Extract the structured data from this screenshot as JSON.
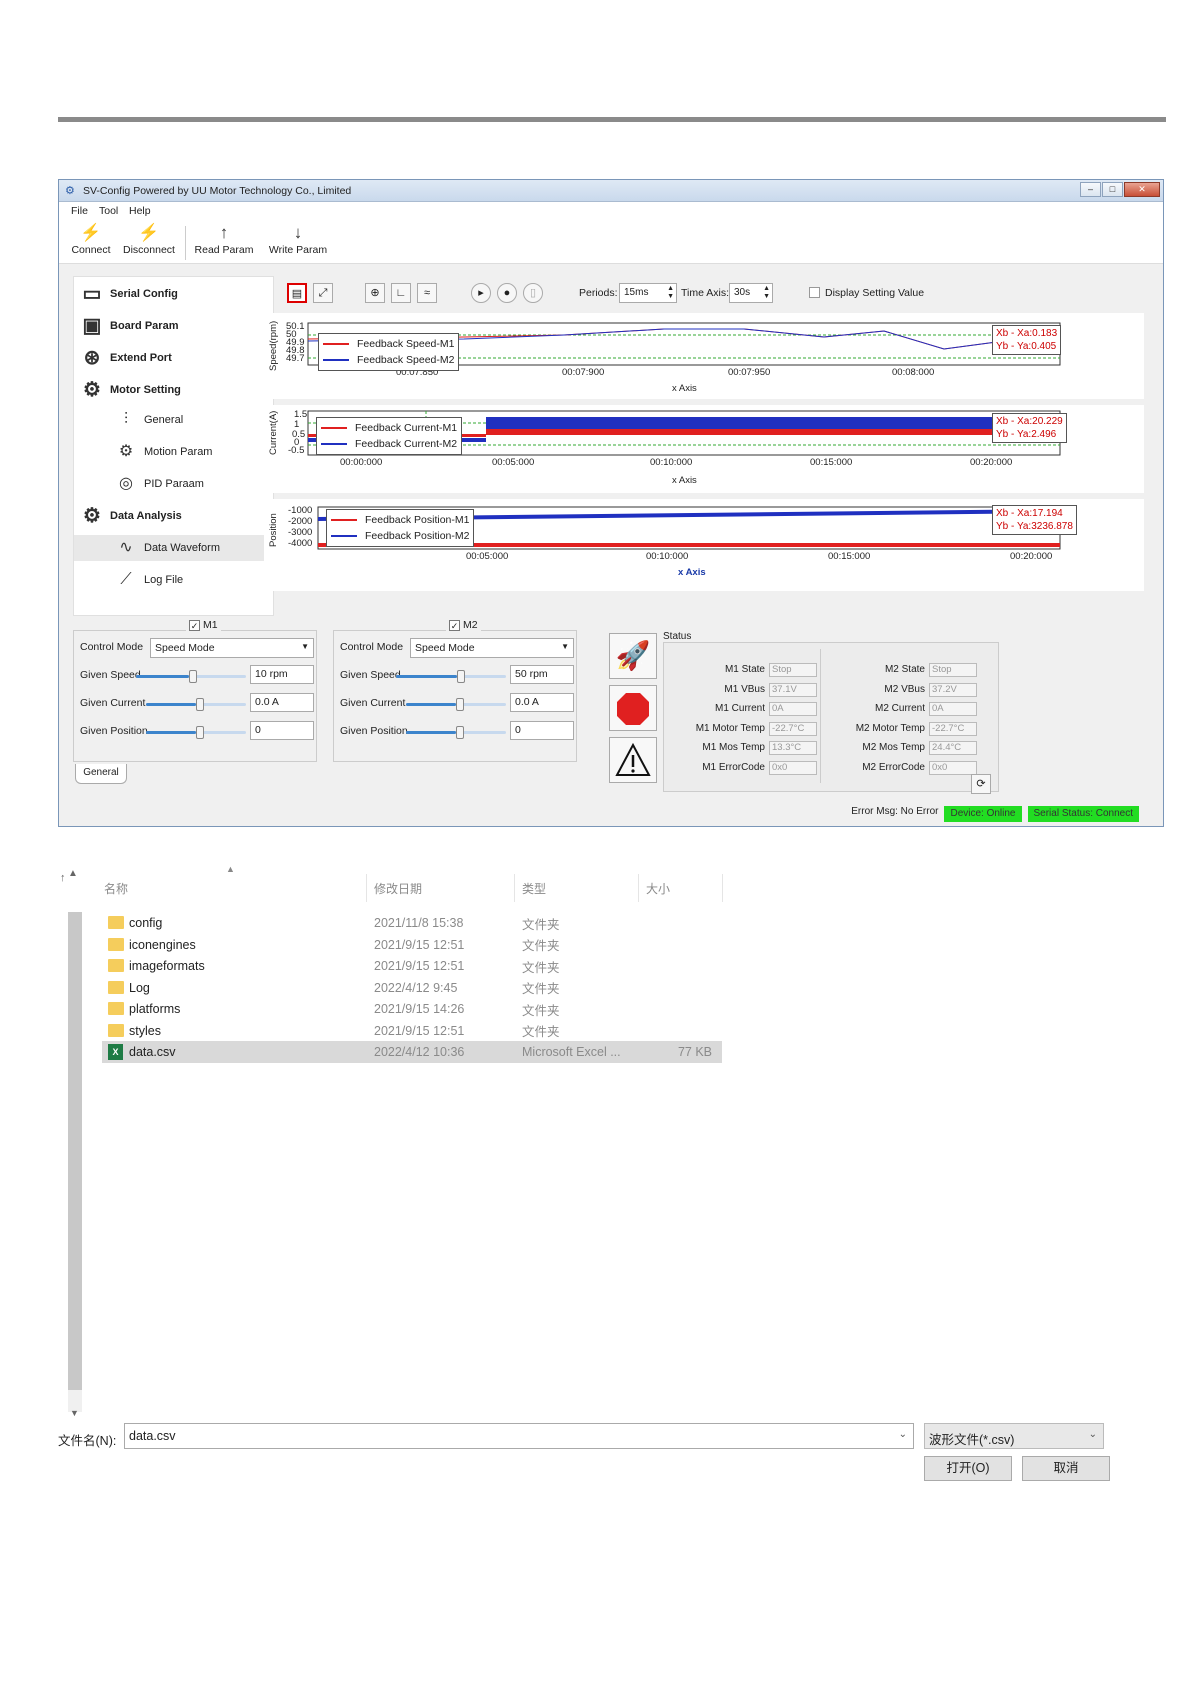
{
  "app": {
    "title": "SV-Config Powered by UU Motor Technology Co., Limited",
    "menu": [
      "File",
      "Tool",
      "Help"
    ],
    "toolbar": {
      "connect": "Connect",
      "disconnect": "Disconnect",
      "read": "Read Param",
      "write": "Write Param"
    },
    "sidebar": {
      "serial": "Serial Config",
      "board": "Board Param",
      "extend": "Extend Port",
      "motor": "Motor Setting",
      "general": "General",
      "motion": "Motion Param",
      "pid": "PID Paraam",
      "analysis": "Data Analysis",
      "waveform": "Data Waveform",
      "logfile": "Log File"
    },
    "controls": {
      "periods_label": "Periods:",
      "periods_value": "15ms",
      "timeaxis_label": "Time Axis:",
      "timeaxis_value": "30s",
      "display_setting": "Display Setting Value"
    },
    "plot1": {
      "ylabel": "Speed(rpm)",
      "xlabel": "x Axis",
      "yticks": [
        "50.1",
        "50",
        "49.9",
        "49.8",
        "49.7"
      ],
      "xticks": [
        "00:07:850",
        "00:07:900",
        "00:07:950",
        "00:08:000"
      ],
      "legend": [
        "Feedback Speed-M1",
        "Feedback Speed-M2"
      ],
      "readout": [
        "Xb - Xa:0.183",
        "Yb - Ya:0.405"
      ]
    },
    "plot2": {
      "ylabel": "Current(A)",
      "xlabel": "x Axis",
      "yticks": [
        "1.5",
        "1",
        "0.5",
        "0",
        "-0.5"
      ],
      "xticks": [
        "00:00:000",
        "00:05:000",
        "00:10:000",
        "00:15:000",
        "00:20:000"
      ],
      "legend": [
        "Feedback Current-M1",
        "Feedback Current-M2"
      ],
      "readout": [
        "Xb - Xa:20.229",
        "Yb - Ya:2.496"
      ]
    },
    "plot3": {
      "ylabel": "Position",
      "xlabel": "x Axis",
      "yticks": [
        "-1000",
        "-2000",
        "-3000",
        "-4000"
      ],
      "xticks": [
        "00:05:000",
        "00:10:000",
        "00:15:000",
        "00:20:000"
      ],
      "legend": [
        "Feedback Position-M1",
        "Feedback Position-M2"
      ],
      "readout": [
        "Xb - Xa:17.194",
        "Yb - Ya:3236.878"
      ]
    },
    "m1": {
      "title": "M1",
      "mode_label": "Control Mode",
      "mode": "Speed Mode",
      "speed_label": "Given Speed",
      "speed": "10 rpm",
      "current_label": "Given Current",
      "current": "0.0 A",
      "position_label": "Given Position",
      "position": "0"
    },
    "m2": {
      "title": "M2",
      "mode_label": "Control Mode",
      "mode": "Speed Mode",
      "speed_label": "Given Speed",
      "speed": "50 rpm",
      "current_label": "Given Current",
      "current": "0.0 A",
      "position_label": "Given Position",
      "position": "0"
    },
    "tab_general": "General",
    "status": {
      "title": "Status",
      "m1": [
        [
          "M1 State",
          "Stop"
        ],
        [
          "M1 VBus",
          "37.1V"
        ],
        [
          "M1 Current",
          "0A"
        ],
        [
          "M1 Motor Temp",
          "-22.7°C"
        ],
        [
          "M1 Mos Temp",
          "13.3°C"
        ],
        [
          "M1 ErrorCode",
          "0x0"
        ]
      ],
      "m2": [
        [
          "M2 State",
          "Stop"
        ],
        [
          "M2 VBus",
          "37.2V"
        ],
        [
          "M2 Current",
          "0A"
        ],
        [
          "M2 Motor Temp",
          "-22.7°C"
        ],
        [
          "M2 Mos Temp",
          "24.4°C"
        ],
        [
          "M2 ErrorCode",
          "0x0"
        ]
      ]
    },
    "statusbar": {
      "error": "Error Msg: No Error",
      "device": "Device: Online",
      "serial": "Serial Status: Connect"
    },
    "colors": {
      "m1": "#e02020",
      "m2": "#2030c0",
      "online": "#22dd22"
    }
  },
  "file_dialog": {
    "headers": {
      "name": "名称",
      "date": "修改日期",
      "type": "类型",
      "size": "大小"
    },
    "rows": [
      {
        "name": "config",
        "date": "2021/11/8 15:38",
        "type": "文件夹",
        "size": ""
      },
      {
        "name": "iconengines",
        "date": "2021/9/15 12:51",
        "type": "文件夹",
        "size": ""
      },
      {
        "name": "imageformats",
        "date": "2021/9/15 12:51",
        "type": "文件夹",
        "size": ""
      },
      {
        "name": "Log",
        "date": "2022/4/12 9:45",
        "type": "文件夹",
        "size": ""
      },
      {
        "name": "platforms",
        "date": "2021/9/15 14:26",
        "type": "文件夹",
        "size": ""
      },
      {
        "name": "styles",
        "date": "2021/9/15 12:51",
        "type": "文件夹",
        "size": ""
      },
      {
        "name": "data.csv",
        "date": "2022/4/12 10:36",
        "type": "Microsoft Excel ...",
        "size": "77 KB"
      }
    ],
    "filename_label": "文件名(N):",
    "filename": "data.csv",
    "filter": "波形文件(*.csv)",
    "open": "打开(O)",
    "cancel": "取消"
  }
}
